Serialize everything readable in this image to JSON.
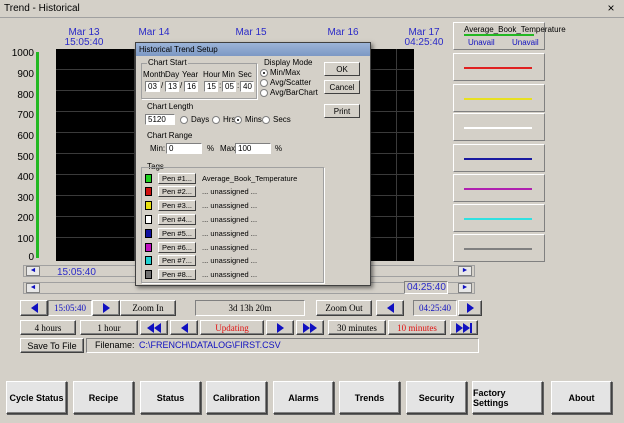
{
  "window": {
    "title": "Trend - Historical",
    "close_glyph": "×"
  },
  "chart": {
    "y_ticks": [
      "1000",
      "900",
      "800",
      "700",
      "600",
      "500",
      "400",
      "300",
      "200",
      "100",
      "0"
    ],
    "x_labels": [
      {
        "date": "Mar 13",
        "time": "15:05:40"
      },
      {
        "date": "Mar 14",
        "time": ""
      },
      {
        "date": "Mar 15",
        "time": ""
      },
      {
        "date": "Mar 16",
        "time": ""
      },
      {
        "date": "Mar 17",
        "time": "04:25:40"
      }
    ],
    "scroll_start": "15:05:40",
    "scroll_end": "04:25:40",
    "axis_color": "#22b822"
  },
  "legend": {
    "header_tag": "Average_Book_Temperature",
    "header_min": "Unavail",
    "header_max": "Unavail",
    "pen_colors": [
      "#e02020",
      "#e8e020",
      "#ffffff",
      "#1a1aa0",
      "#b020b0",
      "#30e0e0",
      "#808080"
    ]
  },
  "controls": {
    "start_time": "15:05:40",
    "zoom_in": "Zoom In",
    "span": "3d 13h 20m",
    "zoom_out": "Zoom Out",
    "end_time": "04:25:40",
    "btn_4h": "4 hours",
    "btn_1h": "1 hour",
    "updating": "Updating",
    "btn_30m": "30 minutes",
    "btn_10m": "10 minutes",
    "save": "Save To File",
    "filename_label": "Filename:",
    "filename": "C:\\FRENCH\\DATALOG\\FIRST.CSV"
  },
  "nav": [
    "Cycle Status",
    "Recipe",
    "Status",
    "Calibration",
    "Alarms",
    "Trends",
    "Security",
    "Factory Settings",
    "About"
  ],
  "dialog": {
    "title": "Historical Trend Setup",
    "chart_start_label": "Chart Start",
    "month_label": "Month",
    "day_label": "Day",
    "year_label": "Year",
    "hour_label": "Hour",
    "min_label": "Min",
    "sec_label": "Sec",
    "month": "03",
    "day": "13",
    "year": "16",
    "hour": "15",
    "min": "05",
    "sec": "40",
    "sep_slash": "/",
    "sep_colon": ":",
    "display_mode_label": "Display Mode",
    "modes": [
      "Min/Max",
      "Avg/Scatter",
      "Avg/BarChart"
    ],
    "selected_mode": 0,
    "ok": "OK",
    "cancel": "Cancel",
    "print": "Print",
    "chart_length_label": "Chart Length",
    "chart_length": "5120",
    "units": [
      "Days",
      "Hrs",
      "Mins",
      "Secs"
    ],
    "selected_unit": 2,
    "chart_range_label": "Chart Range",
    "min_label2": "Min:",
    "min_value": "0",
    "pct1": "%",
    "max_label": "Max:",
    "max_value": "100",
    "pct2": "%",
    "tags_label": "Tags",
    "pens": [
      {
        "label": "Pen #1...",
        "tag": "Average_Book_Temperature",
        "color": "#20d020"
      },
      {
        "label": "Pen #2...",
        "tag": "... unassigned ...",
        "color": "#d01010"
      },
      {
        "label": "Pen #3...",
        "tag": "... unassigned ...",
        "color": "#e8e010"
      },
      {
        "label": "Pen #4...",
        "tag": "... unassigned ...",
        "color": "#ffffff"
      },
      {
        "label": "Pen #5...",
        "tag": "... unassigned ...",
        "color": "#1010a0"
      },
      {
        "label": "Pen #6...",
        "tag": "... unassigned ...",
        "color": "#c010c0"
      },
      {
        "label": "Pen #7...",
        "tag": "... unassigned ...",
        "color": "#20d0d0"
      },
      {
        "label": "Pen #8...",
        "tag": "... unassigned ...",
        "color": "#707070"
      }
    ]
  }
}
